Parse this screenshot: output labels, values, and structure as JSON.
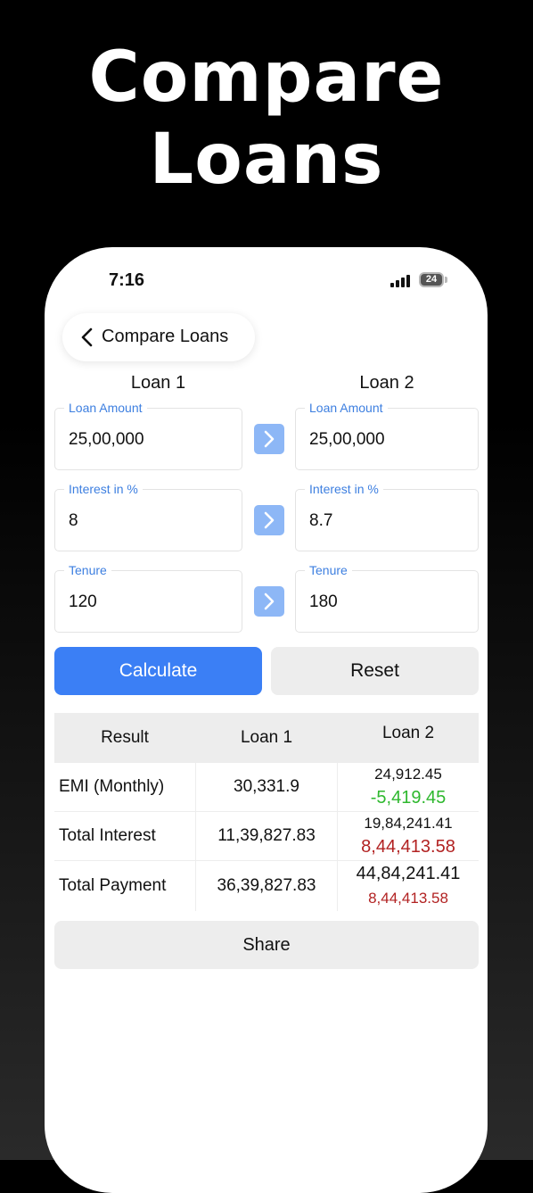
{
  "headline": {
    "line1": "Compare",
    "line2": "Loans"
  },
  "status_bar": {
    "time": "7:16",
    "battery": "24"
  },
  "nav": {
    "back_label": "Compare Loans"
  },
  "columns": {
    "loan1": "Loan 1",
    "loan2": "Loan 2"
  },
  "loan1": {
    "amount_label": "Loan Amount",
    "amount": "25,00,000",
    "interest_label": "Interest in %",
    "interest": "8",
    "tenure_label": "Tenure",
    "tenure": "120"
  },
  "loan2": {
    "amount_label": "Loan Amount",
    "amount": "25,00,000",
    "interest_label": "Interest in %",
    "interest": "8.7",
    "tenure_label": "Tenure",
    "tenure": "180"
  },
  "buttons": {
    "calculate": "Calculate",
    "reset": "Reset",
    "share": "Share"
  },
  "results": {
    "headers": [
      "Result",
      "Loan 1",
      "Loan 2"
    ],
    "rows": [
      {
        "label": "EMI (Monthly)",
        "loan1": "30,331.9",
        "loan2": "24,912.45",
        "diff": "-5,419.45"
      },
      {
        "label": "Total Interest",
        "loan1": "11,39,827.83",
        "loan2": "19,84,241.41",
        "diff": "8,44,413.58"
      },
      {
        "label": "Total Payment",
        "loan1": "36,39,827.83",
        "loan2": "44,84,241.41",
        "diff": "8,44,413.58"
      }
    ]
  },
  "colors": {
    "accent": "#3b7ff5",
    "label_blue": "#3d7fe0",
    "positive": "#2eb82e",
    "negative": "#b22222"
  }
}
